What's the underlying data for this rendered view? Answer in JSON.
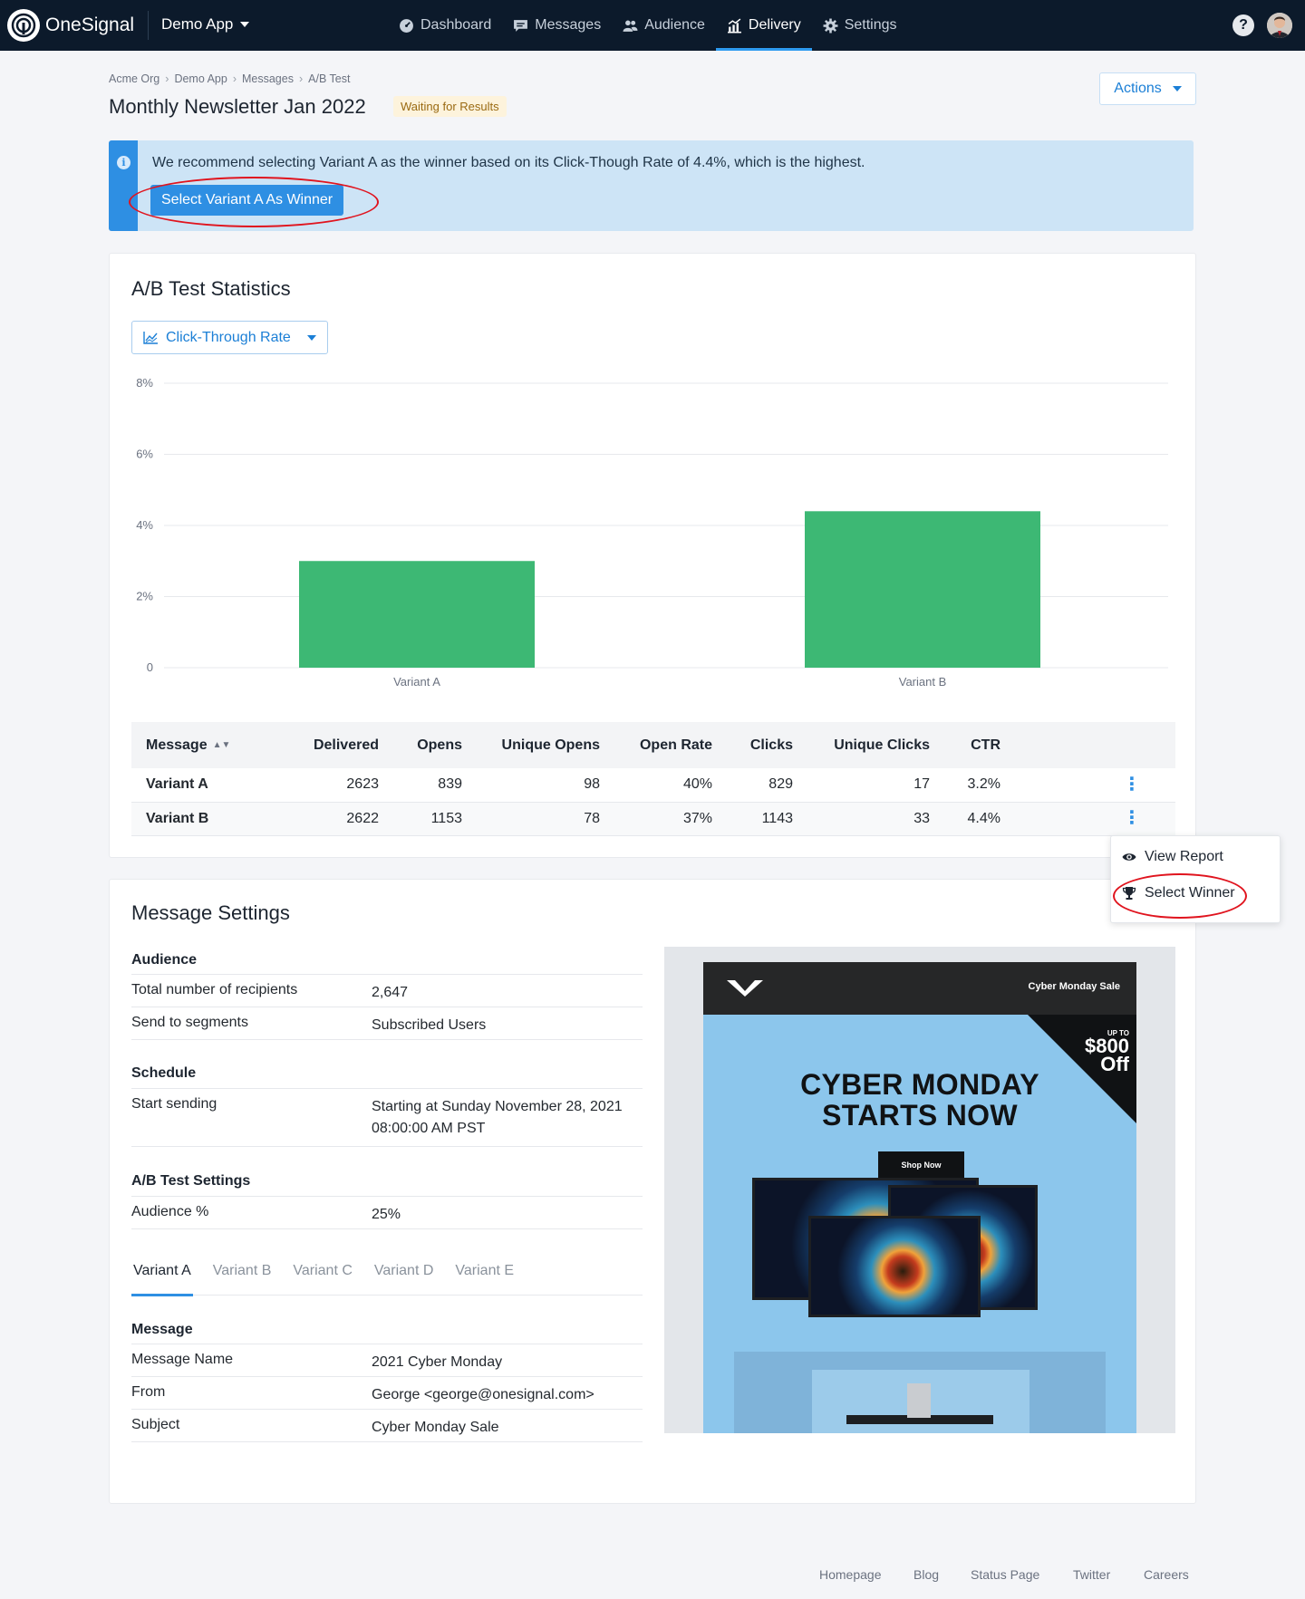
{
  "nav": {
    "logo_text": "OneSignal",
    "app_name": "Demo App",
    "items": [
      {
        "label": "Dashboard",
        "icon": "dashboard-icon"
      },
      {
        "label": "Messages",
        "icon": "messages-icon"
      },
      {
        "label": "Audience",
        "icon": "audience-icon"
      },
      {
        "label": "Delivery",
        "icon": "delivery-icon",
        "active": true
      },
      {
        "label": "Settings",
        "icon": "gear-icon"
      }
    ],
    "help_label": "?"
  },
  "breadcrumb": [
    "Acme Org",
    "Demo App",
    "Messages",
    "A/B Test"
  ],
  "page": {
    "title": "Monthly Newsletter Jan 2022",
    "status": "Waiting for Results",
    "actions_label": "Actions"
  },
  "banner": {
    "text": "We recommend selecting Variant A as the winner based on its Click-Though Rate of 4.4%, which is the highest.",
    "button_label": "Select Variant A As Winner"
  },
  "stats": {
    "title": "A/B Test Statistics",
    "metric_selected": "Click-Through Rate",
    "table": {
      "headers": [
        "Message",
        "Delivered",
        "Opens",
        "Unique Opens",
        "Open Rate",
        "Clicks",
        "Unique Clicks",
        "CTR"
      ],
      "rows": [
        [
          "Variant A",
          "2623",
          "839",
          "98",
          "40%",
          "829",
          "17",
          "3.2%"
        ],
        [
          "Variant B",
          "2622",
          "1153",
          "78",
          "37%",
          "1143",
          "33",
          "4.4%"
        ]
      ]
    }
  },
  "chart_data": {
    "type": "bar",
    "categories": [
      "Variant A",
      "Variant B"
    ],
    "values": [
      3.0,
      4.4
    ],
    "ylim": [
      0,
      8
    ],
    "yticks": [
      0,
      2,
      4,
      6,
      8
    ],
    "ytick_labels": [
      "0",
      "2%",
      "4%",
      "6%",
      "8%"
    ],
    "title": "",
    "xlabel": "",
    "ylabel": "",
    "bar_color": "#3db874",
    "grid": true
  },
  "menu": {
    "items": [
      {
        "label": "View Report",
        "icon": "eye-icon"
      },
      {
        "label": "Select Winner",
        "icon": "trophy-icon"
      }
    ]
  },
  "settings": {
    "title": "Message Settings",
    "audience": {
      "heading": "Audience",
      "rows": [
        {
          "k": "Total number of recipients",
          "v": "2,647"
        },
        {
          "k": "Send to segments",
          "v": "Subscribed Users"
        }
      ]
    },
    "schedule": {
      "heading": "Schedule",
      "rows": [
        {
          "k": "Start sending",
          "v1": "Starting at Sunday November 28, 2021",
          "v2": "08:00:00 AM PST"
        }
      ]
    },
    "ab": {
      "heading": "A/B Test Settings",
      "rows": [
        {
          "k": "Audience %",
          "v": "25%"
        }
      ]
    },
    "tabs": [
      "Variant A",
      "Variant B",
      "Variant C",
      "Variant D",
      "Variant E"
    ],
    "message": {
      "heading": "Message",
      "rows": [
        {
          "k": "Message Name",
          "v": "2021 Cyber Monday"
        },
        {
          "k": "From",
          "v": "George <george@onesignal.com>"
        },
        {
          "k": "Subject",
          "v": "Cyber Monday Sale"
        }
      ]
    }
  },
  "preview": {
    "header_text": "Cyber Monday Sale",
    "corner_small": "UP TO",
    "corner_amount": "$800",
    "corner_off": "Off",
    "headline_1": "CYBER MONDAY",
    "headline_2": "STARTS NOW",
    "button": "Shop Now"
  },
  "footer": [
    "Homepage",
    "Blog",
    "Status Page",
    "Twitter",
    "Careers"
  ],
  "colors": {
    "nav_bg": "#0c1a2b",
    "accent": "#2e8fe3",
    "bar": "#3db874",
    "banner_bg": "#cde4f6",
    "highlight_ring": "#e0141e"
  }
}
